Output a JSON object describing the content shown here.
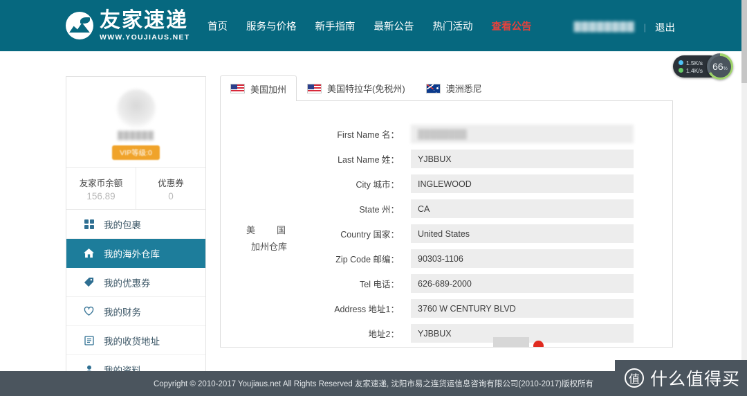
{
  "header": {
    "logo_cn": "友家速递",
    "logo_en": "WWW.YOUJIAUS.NET",
    "nav": [
      {
        "label": "首页",
        "hot": false
      },
      {
        "label": "服务与价格",
        "hot": false
      },
      {
        "label": "新手指南",
        "hot": false
      },
      {
        "label": "最新公告",
        "hot": false
      },
      {
        "label": "热门活动",
        "hot": false
      },
      {
        "label": "查看公告",
        "hot": true
      }
    ],
    "username": "████████",
    "separator": "|",
    "logout": "退出",
    "bg_color": "#06687f",
    "hot_color": "#e8413c"
  },
  "net_widget": {
    "upload": "1.5K/s",
    "download": "1.4K/s",
    "gauge_value": "66",
    "gauge_unit": "%",
    "gauge_color": "#9ed36a"
  },
  "sidebar": {
    "username_blurred": "██████",
    "vip_badge": "VIP等级:0",
    "balance": [
      {
        "label": "友家币余额",
        "value": "156.89"
      },
      {
        "label": "优惠券",
        "value": "0"
      }
    ],
    "items": [
      {
        "label": "我的包裹",
        "icon": "packages-icon",
        "active": false
      },
      {
        "label": "我的海外仓库",
        "icon": "home-icon",
        "active": true
      },
      {
        "label": "我的优惠券",
        "icon": "tag-icon",
        "active": false
      },
      {
        "label": "我的财务",
        "icon": "heart-icon",
        "active": false
      },
      {
        "label": "我的收货地址",
        "icon": "list-icon",
        "active": false
      },
      {
        "label": "我的资料",
        "icon": "user-icon",
        "active": false
      }
    ],
    "active_color": "#1d7d9b"
  },
  "content": {
    "tabs": [
      {
        "label": "美国加州",
        "flag": "us-flag",
        "active": true
      },
      {
        "label": "美国特拉华(免税州)",
        "flag": "us-flag",
        "active": false
      },
      {
        "label": "澳洲悉尼",
        "flag": "au-flag",
        "active": false
      }
    ],
    "warehouse_label_line1": "美　国",
    "warehouse_label_line2": "加州仓库",
    "fields": [
      {
        "label": "First Name 名：",
        "value": "████████",
        "blurred": true
      },
      {
        "label": "Last Name 姓：",
        "value": "YJBBUX",
        "blurred": false
      },
      {
        "label": "City 城市：",
        "value": "INGLEWOOD",
        "blurred": false
      },
      {
        "label": "State 州：",
        "value": "CA",
        "blurred": false
      },
      {
        "label": "Country 国家：",
        "value": "United States",
        "blurred": false
      },
      {
        "label": "Zip Code 邮编：",
        "value": "90303-1106",
        "blurred": false
      },
      {
        "label": "Tel 电话：",
        "value": "626-689-2000",
        "blurred": false
      },
      {
        "label": "Address 地址1：",
        "value": "3760 W CENTURY BLVD",
        "blurred": false
      },
      {
        "label": "地址2：",
        "value": "YJBBUX",
        "blurred": false
      }
    ]
  },
  "footer": {
    "copyright": "Copyright © 2010-2017 Youjiaus.net All Rights Reserved 友家速递, 沈阳市易之连货运信息咨询有限公司(2010-2017)版权所有",
    "bg_color": "#4b555e"
  },
  "watermark": {
    "badge": "值",
    "text": "什么值得买"
  }
}
